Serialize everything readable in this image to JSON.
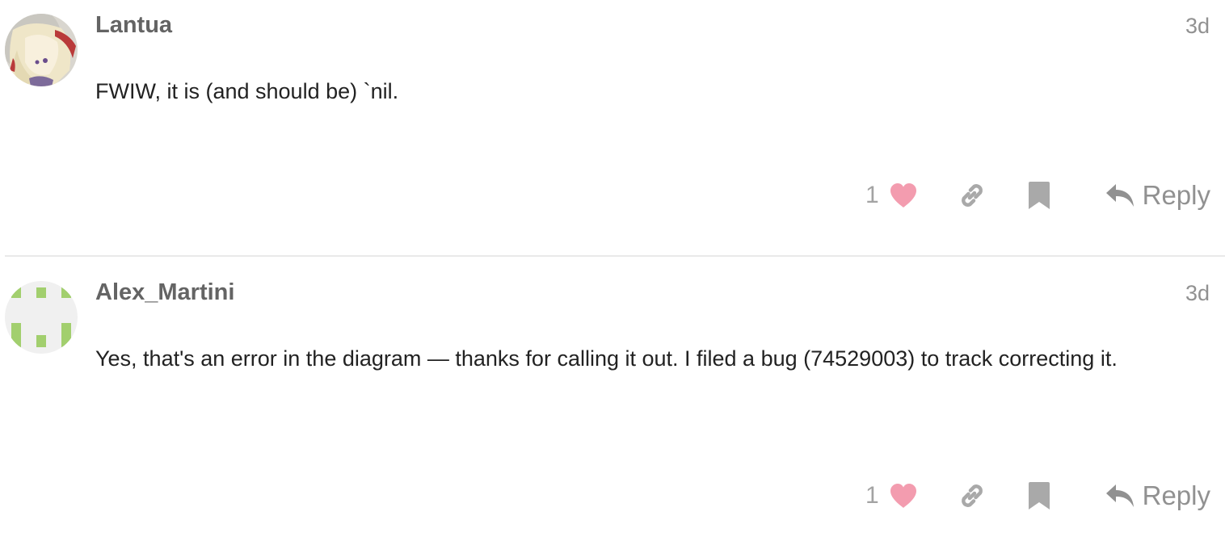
{
  "posts": [
    {
      "username": "Lantua",
      "date": "3d",
      "body": "FWIW, it is (and should be) `nil.",
      "like_count": "1",
      "reply_label": "Reply",
      "avatar_icon": "anime-avatar-image"
    },
    {
      "username": "Alex_Martini",
      "date": "3d",
      "body": "Yes, that's an error in the diagram — thanks for calling it out. I filed a bug (74529003) to track correcting it.",
      "like_count": "1",
      "reply_label": "Reply",
      "avatar_icon": "identicon-avatar"
    }
  ],
  "colors": {
    "heart": "#f39caf",
    "icon_gray": "#a9a9a9",
    "identicon_green": "#a2cf6e",
    "divider": "#e9e9e9"
  }
}
